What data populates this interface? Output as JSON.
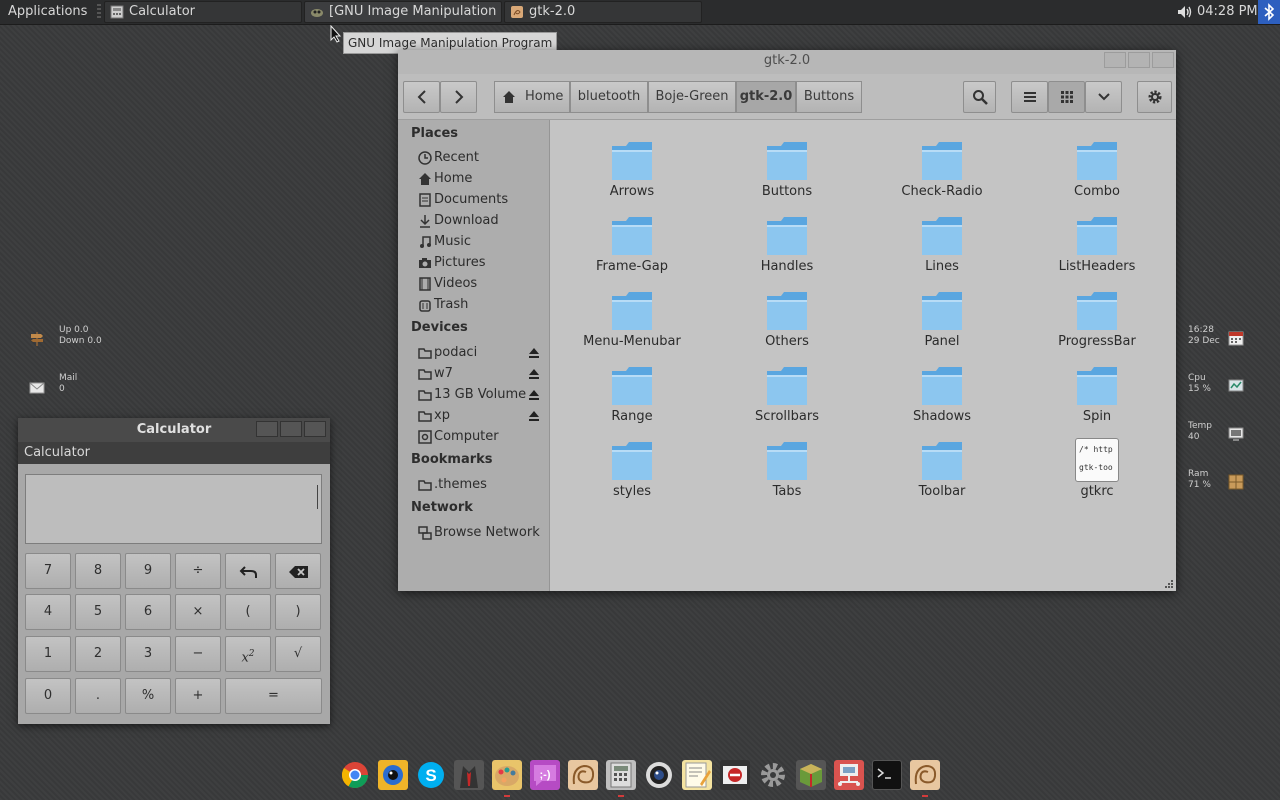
{
  "top_panel": {
    "applications_label": "Applications",
    "tasks": [
      {
        "label": "Calculator"
      },
      {
        "label": "[GNU Image Manipulation P..."
      },
      {
        "label": "gtk-2.0"
      }
    ],
    "clock": "04:28 PM"
  },
  "tooltip": "GNU Image Manipulation Program",
  "file_manager": {
    "title": "gtk-2.0",
    "breadcrumbs": [
      "Home",
      "bluetooth",
      "Boje-Green",
      "gtk-2.0",
      "Buttons"
    ],
    "sidebar": {
      "places_heading": "Places",
      "places": [
        "Recent",
        "Home",
        "Documents",
        "Download",
        "Music",
        "Pictures",
        "Videos",
        "Trash"
      ],
      "devices_heading": "Devices",
      "devices": [
        "podaci",
        "w7",
        "13 GB Volume",
        "xp",
        "Computer"
      ],
      "bookmarks_heading": "Bookmarks",
      "bookmarks": [
        ".themes"
      ],
      "network_heading": "Network",
      "network": [
        "Browse Network"
      ]
    },
    "files": [
      "Arrows",
      "Buttons",
      "Check-Radio",
      "Combo",
      "Frame-Gap",
      "Handles",
      "Lines",
      "ListHeaders",
      "Menu-Menubar",
      "Others",
      "Panel",
      "ProgressBar",
      "Range",
      "Scrollbars",
      "Shadows",
      "Spin",
      "styles",
      "Tabs",
      "Toolbar",
      "gtkrc"
    ],
    "gtkrc_preview": [
      "/* http",
      "gtk-too"
    ]
  },
  "calculator": {
    "title": "Calculator",
    "menu": "Calculator",
    "display": "",
    "keys": [
      "7",
      "8",
      "9",
      "÷",
      "",
      "",
      "4",
      "5",
      "6",
      "×",
      "(",
      ")",
      "1",
      "2",
      "3",
      "−",
      "",
      "√",
      "0",
      ".",
      "%",
      "+",
      "="
    ],
    "square_base": "x",
    "square_exp": "2"
  },
  "conky_left": {
    "net_up": "Up 0.0",
    "net_down": "Down 0.0",
    "mail_label": "Mail",
    "mail_count": "0"
  },
  "conky_right": {
    "time": "16:28",
    "date": "29 Dec",
    "cpu_label": "Cpu",
    "cpu_value": "15 %",
    "temp_label": "Temp",
    "temp_value": "40",
    "ram_label": "Ram",
    "ram_value": "71 %"
  },
  "colors": {
    "folder": "#6fb3e6",
    "accent": "#3b7bd6",
    "dock_indicator": "#d23b3b"
  }
}
